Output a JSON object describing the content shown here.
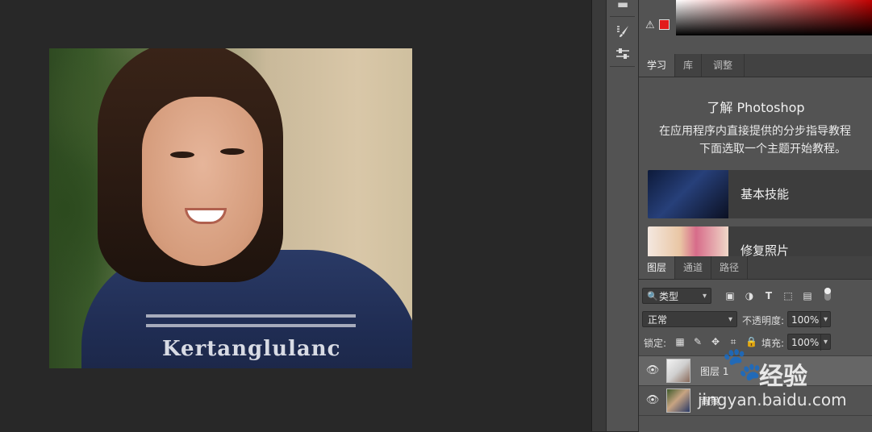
{
  "document": {
    "shirt_text": "Kertanglulanc"
  },
  "panels": {
    "learn_tabs": [
      "学习",
      "库",
      "调整"
    ],
    "learn": {
      "title": "了解 Photoshop",
      "desc_line1": "在应用程序内直接提供的分步指导教程",
      "desc_line2": "下面选取一个主题开始教程。",
      "cards": [
        {
          "label": "基本技能"
        },
        {
          "label": "修复照片"
        }
      ]
    },
    "layer_tabs": [
      "图层",
      "通道",
      "路径"
    ]
  },
  "layers_toolbar": {
    "kind_filter": "类型",
    "blend_mode": "正常",
    "opacity_label": "不透明度:",
    "opacity_value": "100%",
    "lock_label": "锁定:",
    "fill_label": "填充:",
    "fill_value": "100%"
  },
  "layers": [
    {
      "name": "图层 1",
      "selected": true
    },
    {
      "name": "背景",
      "selected": false
    }
  ],
  "watermark": {
    "brand": "经验",
    "url": "jingyan.baidu.com"
  },
  "colors": {
    "accent_warning": "#e21c1c",
    "panel_bg": "#535353",
    "canvas_bg": "#282828"
  }
}
